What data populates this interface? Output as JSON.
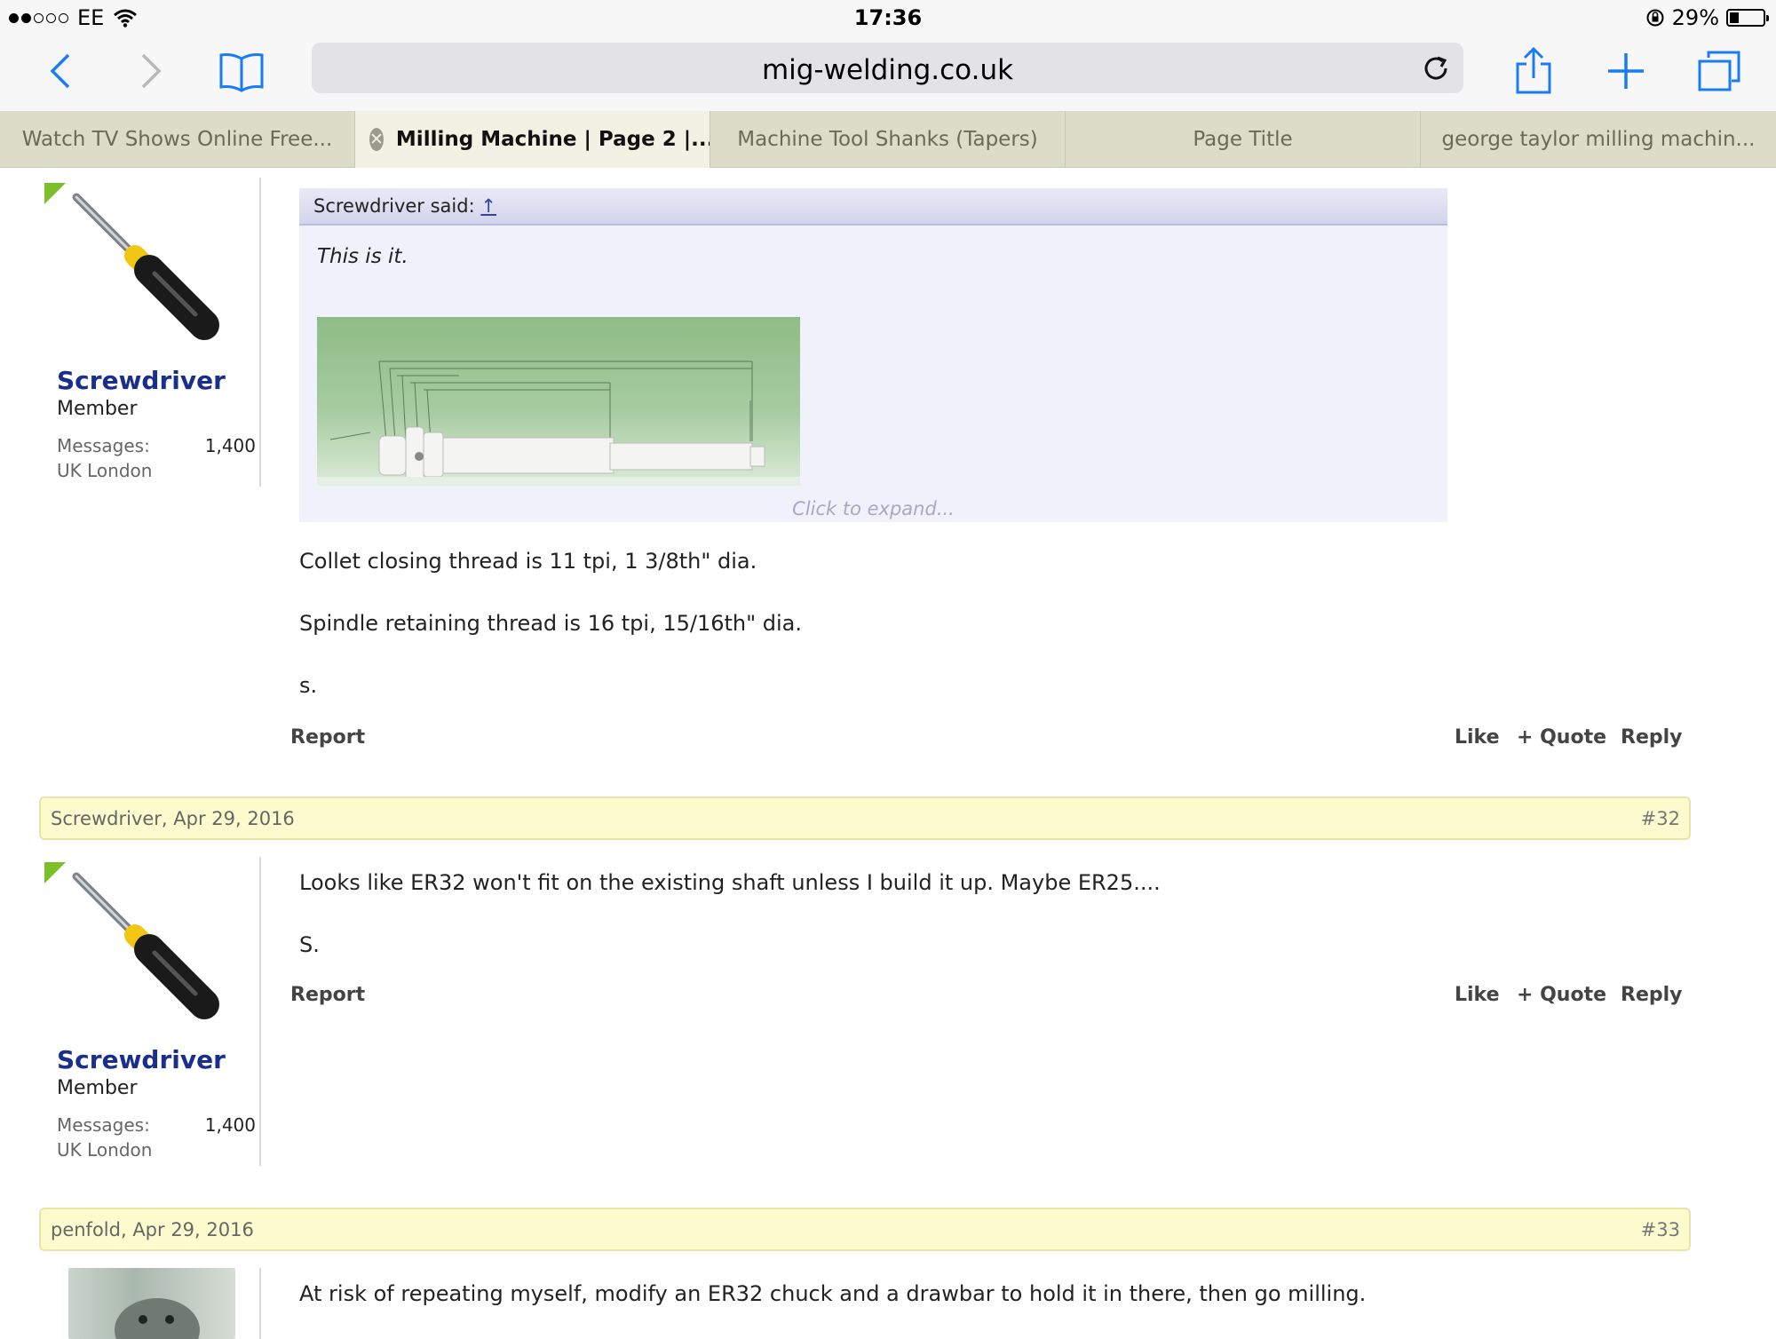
{
  "status": {
    "carrier": "EE",
    "time": "17:36",
    "battery_pct": "29%",
    "battery_level": 0.29
  },
  "browser": {
    "url": "mig-welding.co.uk",
    "tabs": [
      {
        "label": "Watch TV Shows Online Free..."
      },
      {
        "label": "Milling Machine | Page 2 |..."
      },
      {
        "label": "Machine Tool Shanks (Tapers)"
      },
      {
        "label": "Page Title"
      },
      {
        "label": "george taylor milling machin..."
      }
    ]
  },
  "user": {
    "name": "Screwdriver",
    "title": "Member",
    "messages_label": "Messages:",
    "messages_value": "1,400",
    "location": "UK London"
  },
  "post31": {
    "quote_author": "Screwdriver said:",
    "quote_link": "↑",
    "quote_text": "This is it.",
    "expand": "Click to expand...",
    "lines": [
      "Collet closing thread is 11 tpi, 1 3/8th\" dia.",
      "Spindle retaining thread is 16 tpi, 15/16th\" dia.",
      "s."
    ]
  },
  "post32": {
    "header_who": "Screwdriver, Apr 29, 2016",
    "header_num": "#32",
    "lines": [
      "Looks like ER32 won't fit on the existing shaft unless I build it up. Maybe ER25....",
      "S."
    ]
  },
  "post33": {
    "header_who": "penfold, Apr 29, 2016",
    "header_num": "#33",
    "lines": [
      "At risk of repeating myself, modify an ER32 chuck and a drawbar to hold it in there, then go milling."
    ]
  },
  "actions": {
    "report": "Report",
    "like": "Like",
    "quote": "+ Quote",
    "reply": "Reply"
  }
}
